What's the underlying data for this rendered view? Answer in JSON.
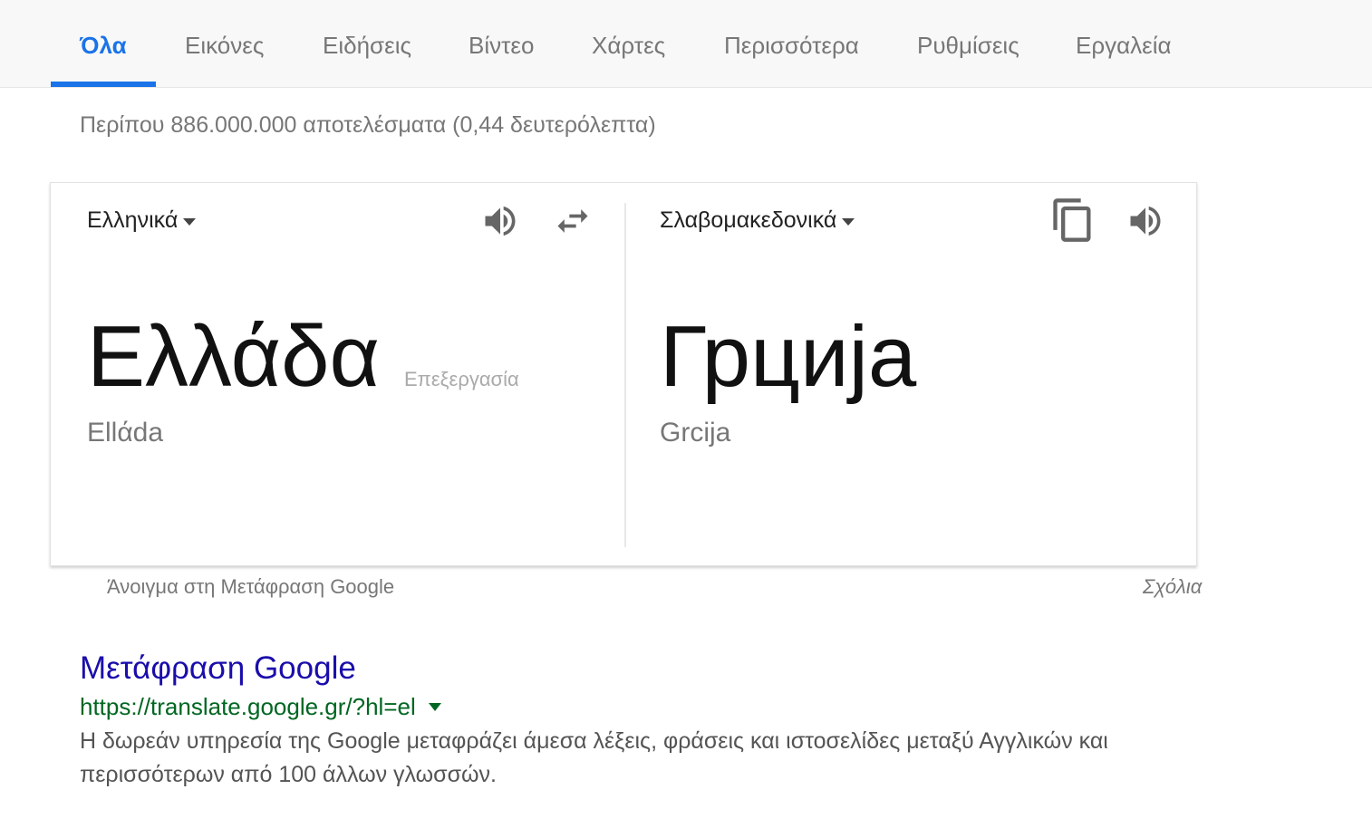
{
  "tabs": [
    {
      "label": "Όλα",
      "active": true
    },
    {
      "label": "Εικόνες"
    },
    {
      "label": "Ειδήσεις"
    },
    {
      "label": "Βίντεο"
    },
    {
      "label": "Χάρτες"
    },
    {
      "label": "Περισσότερα"
    },
    {
      "label": "Ρυθμίσεις"
    },
    {
      "label": "Εργαλεία"
    }
  ],
  "result_stats": "Περίπου 886.000.000 αποτελέσματα (0,44 δευτερόλεπτα)",
  "translate": {
    "source": {
      "language": "Ελληνικά",
      "text": "Ελλάδα",
      "transliteration": "Ellάda",
      "edit_label": "Επεξεργασία"
    },
    "target": {
      "language": "Σλαβομακεδονικά",
      "text": "Грција",
      "transliteration": "Grcija"
    },
    "icons": {
      "source_speaker": "speaker-icon",
      "swap": "swap-icon",
      "copy": "copy-icon",
      "target_speaker": "speaker-icon"
    },
    "open_link": "Άνοιγμα στη Μετάφραση Google",
    "feedback": "Σχόλια"
  },
  "result": {
    "title": "Μετάφραση Google",
    "url": "https://translate.google.gr/?hl=el",
    "snippet": "Η δωρεάν υπηρεσία της Google μεταφράζει άμεσα λέξεις, φράσεις και ιστοσελίδες μεταξύ Αγγλικών και περισσότερων από 100 άλλων γλωσσών."
  },
  "colors": {
    "accent": "#1a73e8",
    "link": "#1a0dab",
    "url": "#006621",
    "muted": "#777777"
  }
}
